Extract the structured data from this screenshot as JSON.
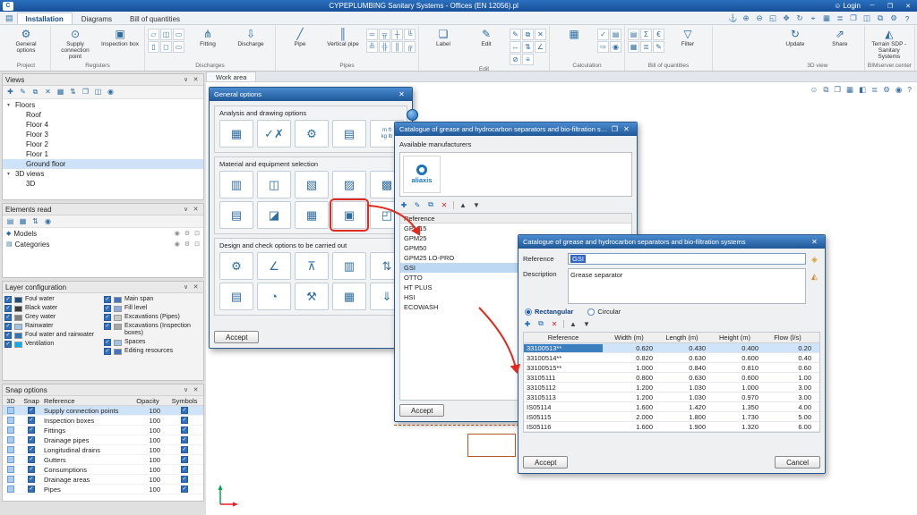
{
  "ui": {
    "check": "✓",
    "chevron": "∨",
    "close": "✕",
    "maximize": "❐",
    "minimize": "─",
    "expander": "▾",
    "user": "☺",
    "logo": "C"
  },
  "colors": {
    "titlebar": "#1e62b0",
    "dialog_title": "#2a6cb3",
    "selection": "#cde3f7",
    "accent_red": "#e02b20"
  },
  "titlebar": {
    "title": "CYPEPLUMBING Sanitary Systems - Offices (EN 12056).pl",
    "login": "Login"
  },
  "tabbar": {
    "tabs": [
      {
        "label": "Installation",
        "active": true
      },
      {
        "label": "Diagrams"
      },
      {
        "label": "Bill of quantities"
      }
    ],
    "quick_icons": [
      {
        "name": "link-icon",
        "glyph": "⚓"
      },
      {
        "name": "zoom-in-icon",
        "glyph": "⊕"
      },
      {
        "name": "zoom-out-icon",
        "glyph": "⊖"
      },
      {
        "name": "zoom-window-icon",
        "glyph": "◱"
      },
      {
        "name": "pan-icon",
        "glyph": "✥"
      },
      {
        "name": "redraw-icon",
        "glyph": "↻"
      },
      {
        "name": "center-view-icon",
        "glyph": "⌖"
      },
      {
        "name": "grid-icon",
        "glyph": "▦"
      },
      {
        "name": "layers-icon",
        "glyph": "≣"
      },
      {
        "name": "new-window-icon",
        "glyph": "❐"
      },
      {
        "name": "tile-windows-icon",
        "glyph": "◫"
      },
      {
        "name": "duplicate-icon",
        "glyph": "⧉"
      },
      {
        "name": "settings-icon",
        "glyph": "⚙"
      },
      {
        "name": "help-icon",
        "glyph": "?"
      }
    ]
  },
  "ribbon": {
    "project": {
      "label": "Project",
      "buttons": [
        {
          "name": "general-options-button",
          "label": "General options",
          "glyph": "⚙"
        }
      ]
    },
    "registers": {
      "label": "Registers",
      "buttons": [
        {
          "name": "supply-connection-point-button",
          "label": "Supply connection point",
          "glyph": "⊙"
        },
        {
          "name": "inspection-box-button",
          "label": "Inspection box",
          "glyph": "▣"
        }
      ]
    },
    "discharges": {
      "label": "Discharges",
      "small": [
        "▱",
        "◫",
        "▭",
        "▯",
        "◻",
        "▭"
      ],
      "buttons": [
        {
          "name": "fitting-button",
          "label": "Fitting",
          "glyph": "⋔"
        },
        {
          "name": "discharge-button",
          "label": "Discharge",
          "glyph": "⇩"
        }
      ]
    },
    "pipes": {
      "label": "Pipes",
      "buttons": [
        {
          "name": "pipe-button",
          "label": "Pipe",
          "glyph": "╱"
        },
        {
          "name": "vertical-pipe-button",
          "label": "Vertical pipe",
          "glyph": "║"
        }
      ],
      "small": [
        "═",
        "╦",
        "┼",
        "╚",
        "╩",
        "╬",
        "║",
        "╔"
      ]
    },
    "edit": {
      "label": "Edit",
      "buttons": [
        {
          "name": "label-button",
          "label": "Label",
          "glyph": "❏"
        },
        {
          "name": "edit-button",
          "label": "Edit",
          "glyph": "✎"
        }
      ],
      "small": [
        "✎",
        "⧉",
        "✕",
        "↔",
        "⇅",
        "∠",
        "⊘",
        "≡"
      ]
    },
    "calculation": {
      "label": "Calculation",
      "buttons": [
        {
          "name": "calculate-button",
          "label": "",
          "glyph": "▦"
        }
      ],
      "small": [
        "✓",
        "▤",
        "⇨",
        "◉"
      ]
    },
    "boq": {
      "label": "Bill of quantities",
      "buttons": [
        {
          "name": "filter-button",
          "label": "Filter",
          "glyph": "▽"
        }
      ],
      "small": [
        "▤",
        "Σ",
        "€",
        "▦",
        "≣",
        "✎"
      ]
    },
    "view3d": {
      "label": "3D view",
      "buttons": [
        {
          "name": "update-button",
          "label": "Update",
          "glyph": "↻"
        },
        {
          "name": "share-button",
          "label": "Share",
          "glyph": "⇗"
        }
      ]
    },
    "bim": {
      "label": "BIMserver.center",
      "buttons": [
        {
          "name": "terrain-sdp-button",
          "label": "Terrain SDP - Sanitary Systems",
          "glyph": "◭"
        }
      ]
    }
  },
  "views_panel": {
    "title": "Views",
    "toolbar": [
      {
        "name": "add-view-icon",
        "glyph": "✚"
      },
      {
        "name": "edit-view-icon",
        "glyph": "✎"
      },
      {
        "name": "duplicate-view-icon",
        "glyph": "⧉"
      },
      {
        "name": "delete-view-icon",
        "glyph": "✕"
      },
      {
        "name": "view-options-icon",
        "glyph": "▦"
      },
      {
        "name": "sort-views-icon",
        "glyph": "⇅"
      },
      {
        "name": "print-view-icon",
        "glyph": "❐"
      },
      {
        "name": "export-view-icon",
        "glyph": "◫"
      },
      {
        "name": "visibility-icon",
        "glyph": "◉"
      }
    ],
    "floors_label": "Floors",
    "floors": [
      {
        "label": "Roof"
      },
      {
        "label": "Floor 4"
      },
      {
        "label": "Floor 3"
      },
      {
        "label": "Floor 2"
      },
      {
        "label": "Floor 1"
      },
      {
        "label": "Ground floor",
        "selected": true
      }
    ],
    "views3d_label": "3D views",
    "views3d": [
      {
        "label": "3D"
      }
    ]
  },
  "elements_panel": {
    "title": "Elements read",
    "toolbar": [
      {
        "name": "list-icon",
        "glyph": "▤"
      },
      {
        "name": "tree-icon",
        "glyph": "▦"
      },
      {
        "name": "sort-icon",
        "glyph": "⇅"
      },
      {
        "name": "visibility-all-icon",
        "glyph": "◉"
      }
    ],
    "rows": [
      {
        "label": "Models",
        "bullet": "◆"
      },
      {
        "label": "Categories",
        "bullet": "▤"
      }
    ],
    "row_icons": {
      "eye": "◉",
      "gear": "⚙",
      "lock": "⊡"
    }
  },
  "layers_panel": {
    "title": "Layer configuration",
    "left": [
      {
        "label": "Foul water",
        "swatch": "#1f4e79"
      },
      {
        "label": "Black water",
        "swatch": "#3b3838"
      },
      {
        "label": "Grey water",
        "swatch": "#7f7f7f"
      },
      {
        "label": "Rainwater",
        "swatch": "#9dc3e6"
      },
      {
        "label": "Foul water and rainwater",
        "swatch": "#2e75b6"
      },
      {
        "label": "Ventilation",
        "swatch": "#00b0f0"
      }
    ],
    "right": [
      {
        "label": "Main span",
        "swatch": "#4472c4"
      },
      {
        "label": "Fill level",
        "swatch": "#8faadc"
      },
      {
        "label": "Excavations (Pipes)",
        "swatch": "#c9c9c9"
      },
      {
        "label": "Excavations (Inspection boxes)",
        "swatch": "#a6a6a6"
      },
      {
        "label": "Spaces",
        "swatch": "#9dc3e6"
      },
      {
        "label": "Editing resources",
        "swatch": "#4472c4"
      }
    ]
  },
  "snap_panel": {
    "title": "Snap options",
    "columns": [
      "3D",
      "Snap",
      "Reference",
      "Opacity",
      "Symbols"
    ],
    "rows": [
      {
        "label": "Supply connection points",
        "opacity": "100",
        "selected": true
      },
      {
        "label": "Inspection boxes",
        "opacity": "100"
      },
      {
        "label": "Fittings",
        "opacity": "100"
      },
      {
        "label": "Drainage pipes",
        "opacity": "100"
      },
      {
        "label": "Longitudinal drains",
        "opacity": "100"
      },
      {
        "label": "Gutters",
        "opacity": "100"
      },
      {
        "label": "Consumptions",
        "opacity": "100"
      },
      {
        "label": "Drainage areas",
        "opacity": "100"
      },
      {
        "label": "Pipes",
        "opacity": "100"
      }
    ]
  },
  "workarea": {
    "tab": "Work area",
    "right_icons": [
      {
        "name": "user-view-icon",
        "glyph": "☺"
      },
      {
        "name": "duplicate-window-icon",
        "glyph": "⧉"
      },
      {
        "name": "new-window-icon",
        "glyph": "❐"
      },
      {
        "name": "grid-icon",
        "glyph": "▦"
      },
      {
        "name": "cube-3d-icon",
        "glyph": "◧"
      },
      {
        "name": "layers-icon",
        "glyph": "≣"
      },
      {
        "name": "settings-icon",
        "glyph": "⚙"
      },
      {
        "name": "capture-icon",
        "glyph": "◉"
      },
      {
        "name": "help-icon",
        "glyph": "?"
      }
    ]
  },
  "general_dialog": {
    "title": "General options",
    "accept": "Accept",
    "sections": [
      {
        "title": "Analysis and drawing options",
        "icons": [
          {
            "name": "calculation-options-icon",
            "glyph": "▦"
          },
          {
            "name": "check-options-icon",
            "glyph": "✓✗"
          },
          {
            "name": "drawing-options-icon",
            "glyph": "⚙"
          },
          {
            "name": "report-options-icon",
            "glyph": "▤"
          },
          {
            "name": "units-options-icon",
            "glyph": "m ft\nkg lb",
            "small": true
          }
        ]
      },
      {
        "title": "Material and equipment selection",
        "icons": [
          {
            "name": "pipes-catalogue-icon",
            "glyph": "▥"
          },
          {
            "name": "inspection-boxes-catalogue-icon",
            "glyph": "◫"
          },
          {
            "name": "pumps-catalogue-icon",
            "glyph": "▧"
          },
          {
            "name": "valves-catalogue-icon",
            "glyph": "▨"
          },
          {
            "name": "gutters-catalogue-icon",
            "glyph": "▩"
          },
          {
            "name": "drains-catalogue-icon",
            "glyph": "▤"
          },
          {
            "name": "manholes-catalogue-icon",
            "glyph": "◪"
          },
          {
            "name": "tanks-catalogue-icon",
            "glyph": "▦"
          },
          {
            "name": "grease-separators-catalogue-icon",
            "glyph": "▣",
            "highlight": true
          },
          {
            "name": "treatment-catalogue-icon",
            "glyph": "◰"
          }
        ]
      },
      {
        "title": "Design and check options to be carried out",
        "icons": [
          {
            "name": "design-gears-icon",
            "glyph": "⚙"
          },
          {
            "name": "slope-check-icon",
            "glyph": "∠"
          },
          {
            "name": "hung-pipes-icon",
            "glyph": "⊼"
          },
          {
            "name": "fill-level-check-icon",
            "glyph": "▥"
          },
          {
            "name": "flow-check-icon",
            "glyph": "⇅"
          },
          {
            "name": "sizing-options-icon",
            "glyph": "▤"
          },
          {
            "name": "velocity-check-icon",
            "glyph": "◔"
          },
          {
            "name": "excavation-options-icon",
            "glyph": "⚒"
          },
          {
            "name": "layout-check-icon",
            "glyph": "▦"
          },
          {
            "name": "vertical-drop-icon",
            "glyph": "⇓"
          }
        ]
      }
    ]
  },
  "catalogue_dialog": {
    "title": "Catalogue of grease and hydrocarbon separators and bio-filtration systems",
    "manufacturers_label": "Available manufacturers",
    "manufacturer_name": "aliaxis",
    "toolbar": [
      {
        "name": "add-icon",
        "glyph": "✚",
        "color": "#1565c0"
      },
      {
        "name": "edit-icon",
        "glyph": "✎",
        "color": "#1565c0"
      },
      {
        "name": "copy-icon",
        "glyph": "⧉",
        "color": "#1565c0"
      },
      {
        "name": "delete-icon",
        "glyph": "✕",
        "color": "#c62828"
      },
      {
        "name": "toolbar-separator",
        "sep": true
      },
      {
        "name": "move-up-icon",
        "glyph": "▲",
        "color": "#444444"
      },
      {
        "name": "move-down-icon",
        "glyph": "▼",
        "color": "#444444"
      }
    ],
    "list_header": "Reference",
    "items": [
      {
        "label": "GPM15"
      },
      {
        "label": "GPM25"
      },
      {
        "label": "GPM50"
      },
      {
        "label": "GPM25 LO-PRO"
      },
      {
        "label": "GSI",
        "selected": true
      },
      {
        "label": "OTTO"
      },
      {
        "label": "HT PLUS"
      },
      {
        "label": "HSI"
      },
      {
        "label": "ECOWASH"
      }
    ],
    "accept": "Accept"
  },
  "detail_dialog": {
    "title": "Catalogue of grease and hydrocarbon separators and bio-filtration systems",
    "reference_label": "Reference",
    "reference_value": "GSI",
    "side_icons": [
      {
        "name": "import-from-library-icon",
        "glyph": "◈",
        "color": "#d99a27"
      },
      {
        "name": "export-to-library-icon",
        "glyph": "◭",
        "color": "#d98427"
      }
    ],
    "description_label": "Description",
    "description_value": "Grease separator",
    "shapes": [
      {
        "label": "Rectangular",
        "selected": true
      },
      {
        "label": "Circular"
      }
    ],
    "toolbar": [
      {
        "name": "add-icon",
        "glyph": "✚",
        "color": "#1565c0"
      },
      {
        "name": "copy-icon",
        "glyph": "⧉",
        "color": "#1565c0"
      },
      {
        "name": "delete-icon",
        "glyph": "✕",
        "color": "#c62828"
      },
      {
        "name": "toolbar-separator",
        "sep": true
      },
      {
        "name": "move-up-icon",
        "glyph": "▲",
        "color": "#444444"
      },
      {
        "name": "move-down-icon",
        "glyph": "▼",
        "color": "#444444"
      }
    ],
    "columns": [
      "Reference",
      "Width (m)",
      "Length (m)",
      "Height (m)",
      "Flow (l/s)"
    ],
    "rows": [
      {
        "cells": [
          "33100513**",
          "0.620",
          "0.430",
          "0.400",
          "0.20"
        ],
        "selected": true
      },
      {
        "cells": [
          "33100514**",
          "0.820",
          "0.630",
          "0.600",
          "0.40"
        ]
      },
      {
        "cells": [
          "33100515**",
          "1.000",
          "0.840",
          "0.810",
          "0.60"
        ]
      },
      {
        "cells": [
          "33105111",
          "0.800",
          "0.630",
          "0.600",
          "1.00"
        ]
      },
      {
        "cells": [
          "33105112",
          "1.200",
          "1.030",
          "1.000",
          "3.00"
        ]
      },
      {
        "cells": [
          "33105113",
          "1.200",
          "1.030",
          "0.970",
          "3.00"
        ]
      },
      {
        "cells": [
          "IS05114",
          "1.600",
          "1.420",
          "1.350",
          "4.00"
        ]
      },
      {
        "cells": [
          "IS05115",
          "2.000",
          "1.800",
          "1.730",
          "5.00"
        ]
      },
      {
        "cells": [
          "IS05116",
          "1.600",
          "1.900",
          "1.320",
          "6.00"
        ]
      }
    ],
    "accept": "Accept",
    "cancel": "Cancel"
  }
}
